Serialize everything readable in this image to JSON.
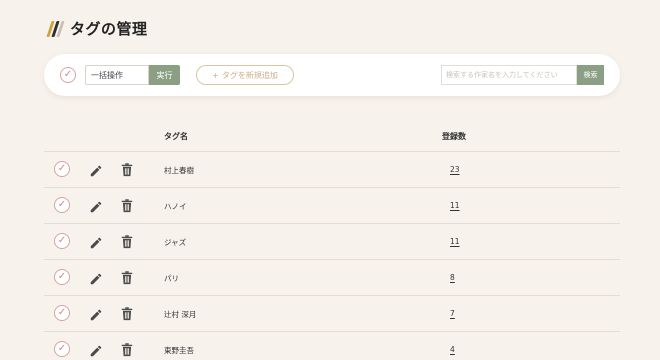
{
  "header": {
    "title": "タグの管理",
    "logo_icon": "bookshelf-logo-icon"
  },
  "toolbar": {
    "bulk_action": {
      "selected": "一括操作"
    },
    "run_label": "実行",
    "add_tag_label": "タグを新規追加",
    "add_icon": "plus-icon",
    "search": {
      "placeholder": "検索する作家名を入力してください",
      "value": ""
    },
    "search_label": "検索"
  },
  "table": {
    "columns": {
      "name": "タグ名",
      "count": "登録数"
    },
    "rows": [
      {
        "name": "村上春樹",
        "count": "23"
      },
      {
        "name": "ハノイ",
        "count": "11"
      },
      {
        "name": "ジャズ",
        "count": "11"
      },
      {
        "name": "パリ",
        "count": "8"
      },
      {
        "name": "辻村 深月",
        "count": "7"
      },
      {
        "name": "東野圭吾",
        "count": "4"
      }
    ]
  },
  "colors": {
    "background": "#f7f2ec",
    "accent_green": "#8a9f83",
    "checkbox_pink": "#d9a2a2",
    "add_button_tan": "#d9c6a3"
  }
}
